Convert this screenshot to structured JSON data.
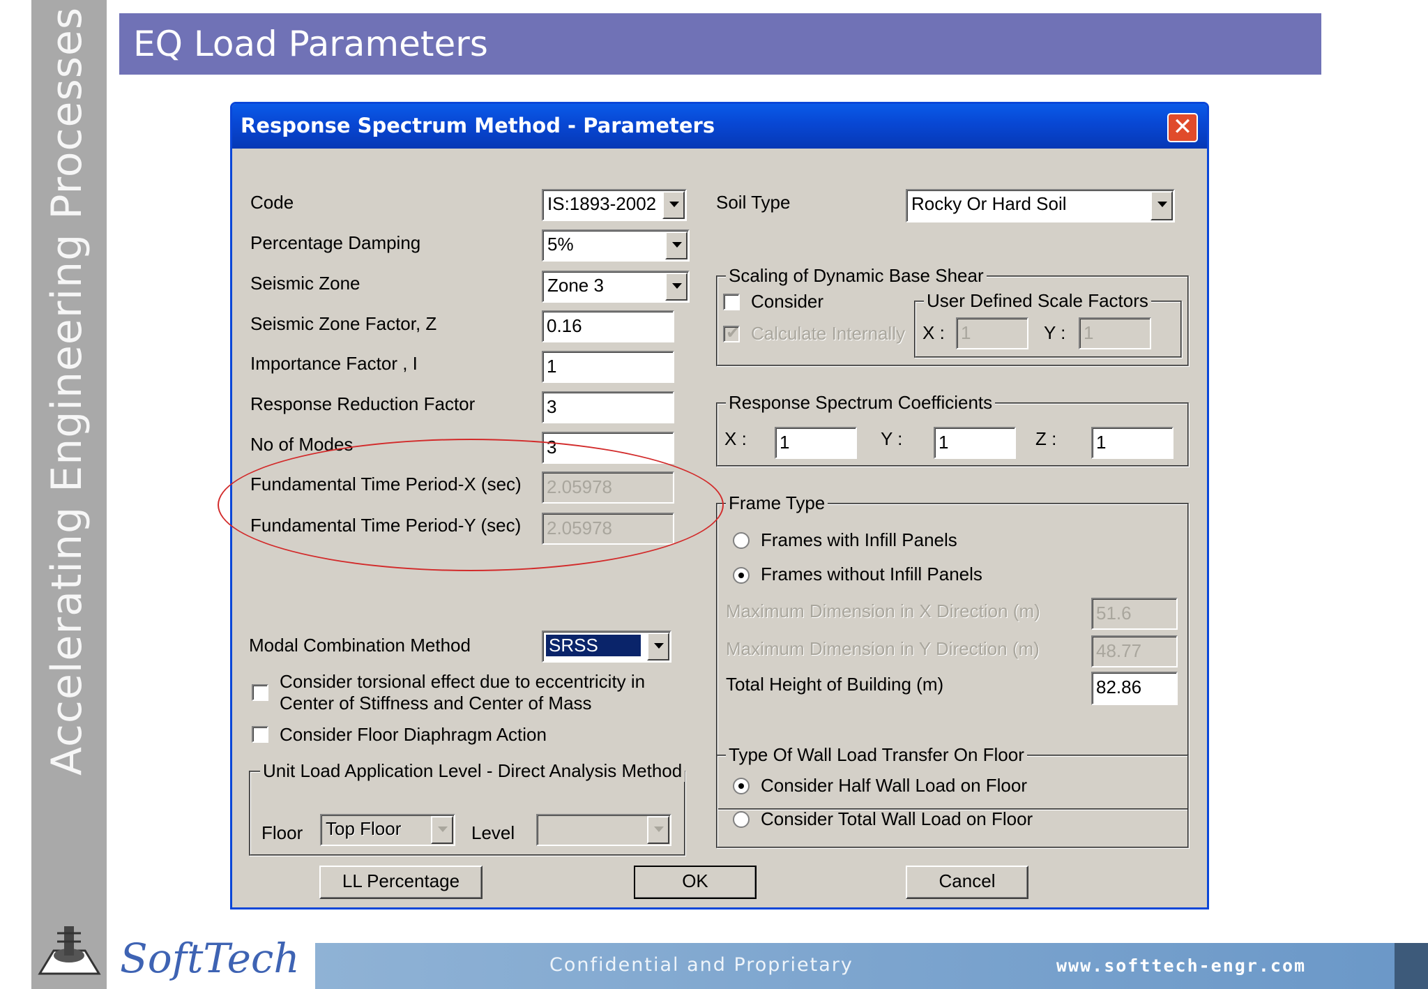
{
  "slide": {
    "title": "EQ Load Parameters",
    "sidebar_text": "Accelerating Engineering Processes",
    "logo": "SoftTech",
    "footer_text": "Confidential  and  Proprietary",
    "footer_url": "www.softtech-engr.com"
  },
  "dialog": {
    "title": "Response Spectrum Method - Parameters",
    "close": "✕",
    "left": {
      "code": {
        "label": "Code",
        "value": "IS:1893-2002"
      },
      "damping": {
        "label": "Percentage Damping",
        "value": "5%"
      },
      "zone": {
        "label": "Seismic Zone",
        "value": "Zone 3"
      },
      "zone_factor": {
        "label": "Seismic Zone Factor, Z",
        "value": "0.16"
      },
      "importance": {
        "label": "Importance Factor , I",
        "value": "1"
      },
      "reduction": {
        "label": "Response Reduction Factor",
        "value": "3"
      },
      "modes": {
        "label": "No of Modes",
        "value": "3"
      },
      "period_x": {
        "label": "Fundamental Time Period-X (sec)",
        "value": "2.05978"
      },
      "period_y": {
        "label": "Fundamental Time Period-Y (sec)",
        "value": "2.05978"
      },
      "modal": {
        "label": "Modal Combination Method",
        "value": "SRSS"
      },
      "torsional_line1": "Consider torsional effect due to eccentricity in",
      "torsional_line2": "Center of Stiffness and Center of Mass",
      "diaphragm": "Consider Floor Diaphragm Action",
      "unit_load": {
        "title": "Unit Load Application Level - Direct Analysis Method",
        "floor_label": "Floor",
        "floor_value": "Top Floor",
        "level_label": "Level",
        "level_value": ""
      }
    },
    "right": {
      "soil": {
        "label": "Soil Type",
        "value": "Rocky Or Hard Soil"
      },
      "scaling": {
        "title": "Scaling of Dynamic Base Shear",
        "consider": "Consider",
        "calc": "Calculate Internally",
        "user_title": "User Defined Scale Factors",
        "x_label": "X :",
        "x_value": "1",
        "y_label": "Y :",
        "y_value": "1"
      },
      "rsc": {
        "title": "Response Spectrum Coefficients",
        "x_label": "X :",
        "x_value": "1",
        "y_label": "Y :",
        "y_value": "1",
        "z_label": "Z :",
        "z_value": "1"
      },
      "frame": {
        "title": "Frame Type",
        "opt1": "Frames with Infill Panels",
        "opt2": "Frames without Infill Panels",
        "maxx_label": "Maximum Dimension in X Direction  (m)",
        "maxx_value": "51.6",
        "maxy_label": "Maximum Dimension in Y Direction  (m)",
        "maxy_value": "48.77",
        "height_label": "Total Height of Building  (m)",
        "height_value": "82.86"
      },
      "wall": {
        "title": "Type Of Wall Load Transfer On Floor",
        "opt1": "Consider Half Wall  Load on Floor",
        "opt2": "Consider Total  Wall  Load on Floor"
      }
    },
    "buttons": {
      "ll": "LL Percentage",
      "ok": "OK",
      "cancel": "Cancel"
    }
  }
}
